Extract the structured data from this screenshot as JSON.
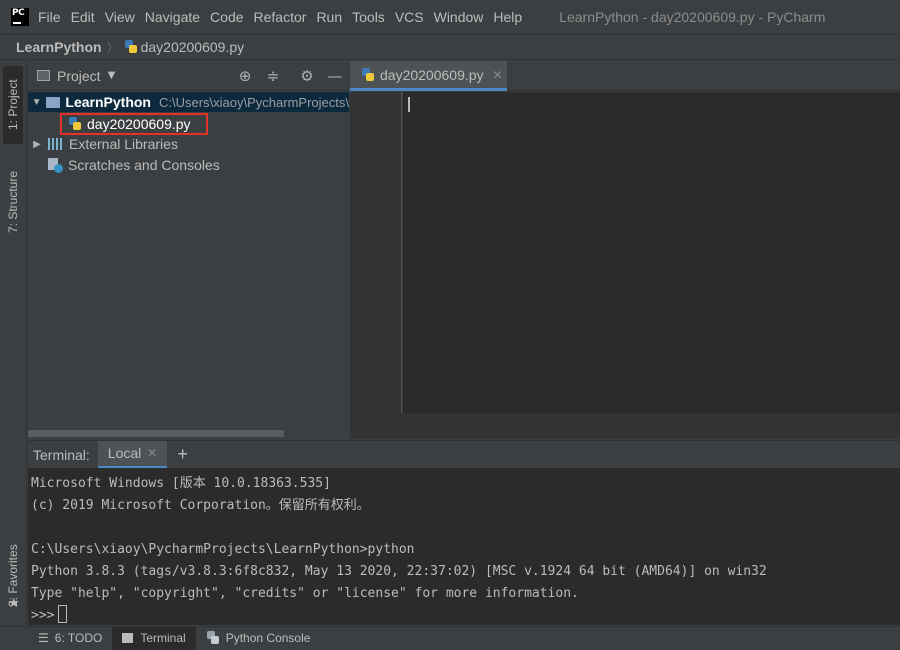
{
  "menubar": {
    "items": [
      "File",
      "Edit",
      "View",
      "Navigate",
      "Code",
      "Refactor",
      "Run",
      "Tools",
      "VCS",
      "Window",
      "Help"
    ],
    "window_title": "LearnPython - day20200609.py - PyCharm"
  },
  "navbar": {
    "project": "LearnPython",
    "file": "day20200609.py"
  },
  "left_strip": {
    "project_tab": "1: Project",
    "structure_tab": "7: Structure",
    "favorites_tab": "2: Favorites"
  },
  "project_panel": {
    "title": "Project",
    "root_name": "LearnPython",
    "root_path": "C:\\Users\\xiaoy\\PycharmProjects\\",
    "file": "day20200609.py",
    "external_libraries": "External Libraries",
    "scratches": "Scratches and Consoles"
  },
  "editor": {
    "tab_label": "day20200609.py"
  },
  "terminal": {
    "label": "Terminal:",
    "tab": "Local",
    "lines": [
      "Microsoft Windows [版本 10.0.18363.535]",
      "(c) 2019 Microsoft Corporation。保留所有权利。",
      "",
      "C:\\Users\\xiaoy\\PycharmProjects\\LearnPython>python",
      "Python 3.8.3 (tags/v3.8.3:6f8c832, May 13 2020, 22:37:02) [MSC v.1924 64 bit (AMD64)] on win32",
      "Type \"help\", \"copyright\", \"credits\" or \"license\" for more information.",
      ">>>"
    ]
  },
  "bottom_bar": {
    "todo": "6: TODO",
    "terminal": "Terminal",
    "python_console": "Python Console"
  },
  "colors": {
    "accent": "#4a88c7",
    "highlight_border": "#e4322b",
    "selection": "#0d293e",
    "background": "#3c3f41",
    "editor_bg": "#2b2b2b"
  }
}
